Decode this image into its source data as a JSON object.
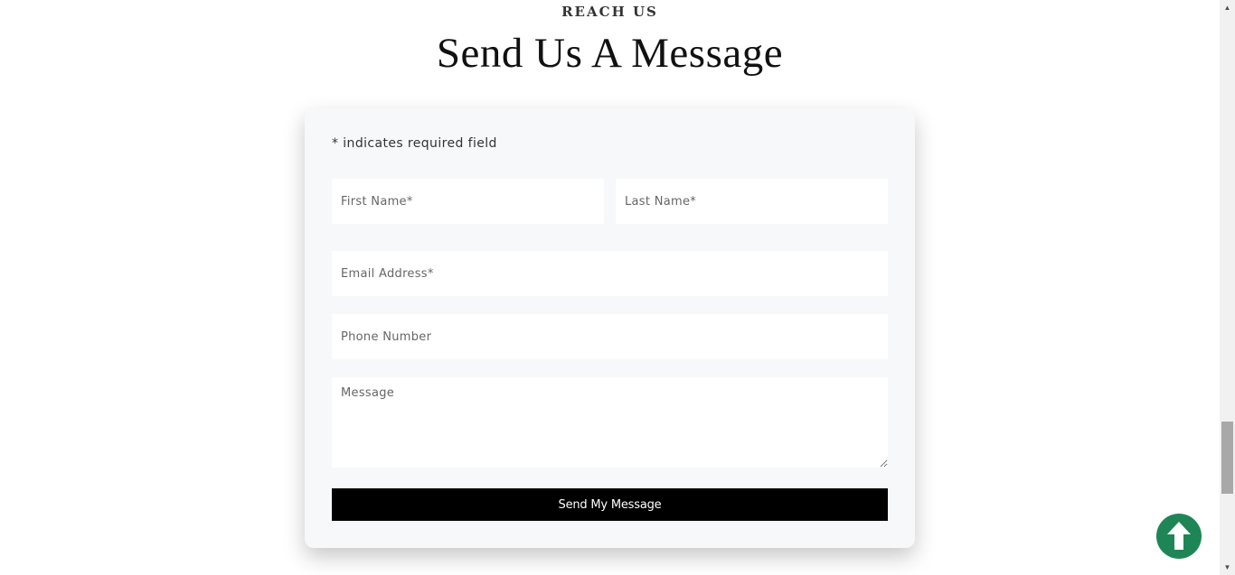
{
  "section": {
    "eyebrow": "REACH US",
    "title": "Send Us A Message"
  },
  "form": {
    "required_note": "* indicates required field",
    "first_name_placeholder": "First Name*",
    "last_name_placeholder": "Last Name*",
    "email_placeholder": "Email Address*",
    "phone_placeholder": "Phone Number",
    "message_placeholder": "Message",
    "submit_label": "Send My Message"
  },
  "scroll_to_top": {
    "icon": "arrow-up-icon",
    "color": "#1e8656"
  },
  "colors": {
    "card_background": "#f7f8f9",
    "button_background": "#000000",
    "button_text": "#ffffff"
  }
}
